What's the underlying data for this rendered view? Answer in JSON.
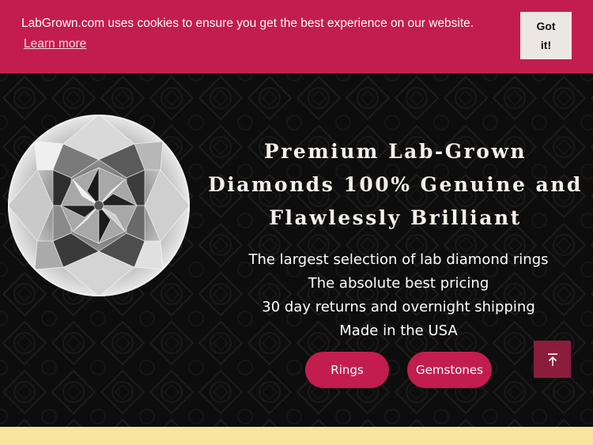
{
  "cookie_banner": {
    "message": "LabGrown.com uses cookies to ensure you get the best experience on our website.",
    "learn_more": "Learn more",
    "accept_label": "Got it!",
    "background_color": "#c21d4e"
  },
  "hero": {
    "title": "Premium Lab-Grown Diamonds 100% Genuine and Flawlessly Brilliant",
    "features": [
      "The largest selection of lab diamond rings",
      "The absolute best pricing",
      "30 day returns and overnight shipping",
      "Made in the USA"
    ],
    "buttons": {
      "rings": "Rings",
      "gemstones": "Gemstones"
    },
    "image_subject": "round brilliant diamond",
    "accent_color": "#c21d4e"
  },
  "back_to_top_icon": "arrow-up-to-line-icon",
  "footer_band_color": "#f9e59d"
}
